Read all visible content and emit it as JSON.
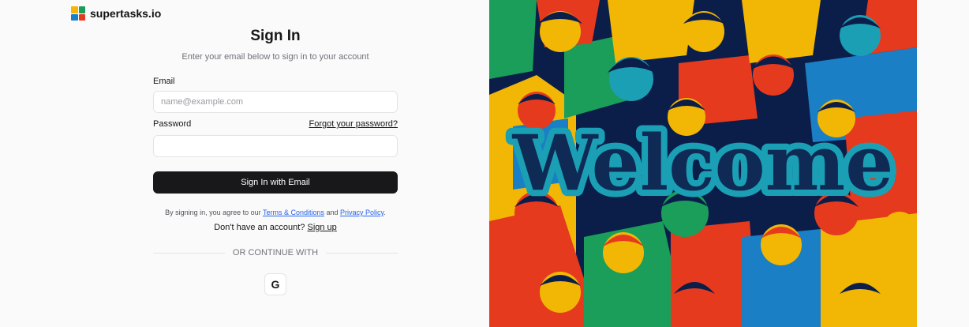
{
  "brand": {
    "name": "supertasks.io"
  },
  "signin": {
    "title": "Sign In",
    "subtitle": "Enter your email below to sign in to your account",
    "email_label": "Email",
    "email_placeholder": "name@example.com",
    "password_label": "Password",
    "forgot_label": "Forgot your password?",
    "submit_label": "Sign In with Email",
    "terms_prefix": "By signing in, you agree to our ",
    "terms_link": "Terms & Conditions",
    "terms_and": " and ",
    "privacy_link": "Privacy Policy",
    "terms_suffix": ".",
    "no_account": "Don't have an account? ",
    "signup_link": "Sign up",
    "divider": "OR CONTINUE WITH",
    "google_letter": "G"
  },
  "hero": {
    "welcome_text": "Welcome"
  },
  "icons": {
    "logo": "supertasks-logo-icon",
    "google": "google-icon"
  },
  "colors": {
    "primary_button": "#18181b",
    "link": "#2563eb",
    "hero_background": "#0b1e4a",
    "welcome_teal": "#1b9fb5",
    "welcome_dark": "#0e2a55",
    "logo": [
      "#f2b705",
      "#1a9e5a",
      "#1a7fc4",
      "#e63a1f"
    ]
  }
}
